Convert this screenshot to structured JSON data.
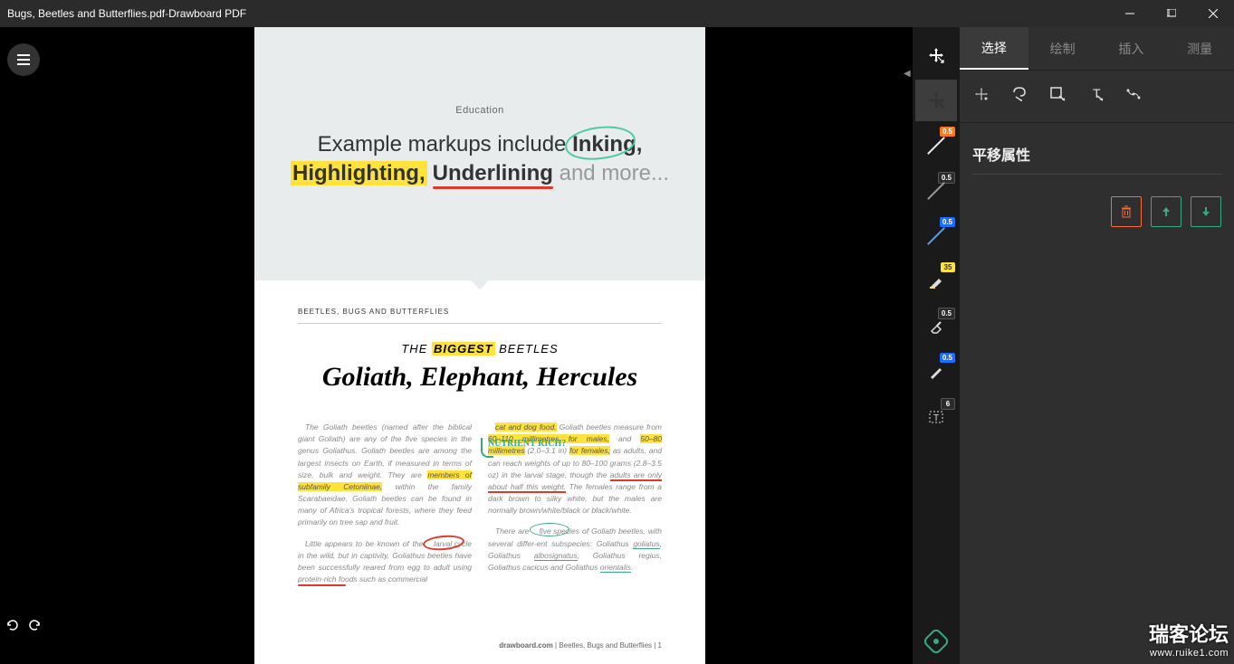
{
  "title": {
    "filename": "Bugs, Beetles and Butterflies.pdf",
    "sep": " - ",
    "app": "Drawboard PDF"
  },
  "header": {
    "category": "Education",
    "line1_a": "Example markups include ",
    "inking": "Inking,",
    "highlighting": "Highlighting,",
    "underlining": "Underlining",
    "andmore": " and more..."
  },
  "doc": {
    "smallcaps": "BEETLES, BUGS AND BUTTERFLIES",
    "the": "THE ",
    "biggest": "BIGGEST",
    "beetles": " BEETLES",
    "title2": "Goliath, Elephant, Hercules",
    "nutrient": "NUTRIENT RICH?",
    "col1p1a": "The Goliath beetles (named after the biblical giant Goliath) are any of the five species in the genus Goliathus. Goliath beetles are among the largest insects on Earth, if measured in terms of size, bulk and weight. They are ",
    "col1p1hl": "members of subfamily Cetoniinae,",
    "col1p1b": " within the family Scarabaeidae. Goliath beetles can be found in many of Africa's tropical forests, where they feed primarily on tree sap and fruit.",
    "col1p2a": "Little appears to be known of the ",
    "col1p2circle": "larval cycle",
    "col1p2b": " in the wild, but in captivity, Goliathus beetles have been successfully reared from egg to adult using ",
    "col1p2ul": "protein-rich",
    "col1p2c": " foods such as commercial",
    "col2p1a_hl": "cat and dog food.",
    "col2p1b": " Goliath beetles measure from ",
    "col2p1c_hl": "60–110 millimetres for males,",
    "col2p1d": " and ",
    "col2p1e_hl": "50–80 millimetres",
    "col2p1f": " (2.0–3.1 in) ",
    "col2p1g_hl": "for females,",
    "col2p1h": " as adults, and can reach weights of up to 80–100 grams (2.8–3.5 oz) in the larval stage, though the ",
    "col2p1i_ul": "adults are only about half this weight.",
    "col2p1j": " The females range from a dark brown to silky white, but the males are normally brown/white/black or black/white.",
    "col2p2a": "There are ",
    "col2p2circle": "five species",
    "col2p2b": " of Goliath beetles, with several differ-ent subspecies: Goliathus ",
    "col2p2ul1": "goliatus",
    "col2p2c": ", Goliathus ",
    "col2p2ul2": "albosignatus",
    "col2p2d": ", Goliathus regius, Goliathus cacicus and Goliathus ",
    "col2p2ul3": "orientalis",
    "col2p2e": ".",
    "footer_site": "drawboard.com",
    "footer_rest": "   |   Beetles, Bugs and Butterflies   |   1"
  },
  "mid_tools": [
    {
      "name": "pan-tool",
      "badge": null
    },
    {
      "name": "pen-orange",
      "badge": "0.5",
      "badgeColor": "orange"
    },
    {
      "name": "pen-gray",
      "badge": "0.5",
      "badgeColor": "dkgray"
    },
    {
      "name": "pen-blue",
      "badge": "0.5",
      "badgeColor": "blue"
    },
    {
      "name": "highlighter",
      "badge": "35",
      "badgeColor": "yellow"
    },
    {
      "name": "eraser",
      "badge": "0.5",
      "badgeColor": "dkgray"
    },
    {
      "name": "pen-blue2",
      "badge": "0.5",
      "badgeColor": "blue"
    },
    {
      "name": "text-tool",
      "badge": "6",
      "badgeColor": "dkgray"
    }
  ],
  "tabs": {
    "select": "选择",
    "draw": "绘制",
    "insert": "插入",
    "measure": "测量"
  },
  "panel": {
    "prop_title": "平移属性"
  },
  "watermark": {
    "l1": "瑞客论坛",
    "l2": "www.ruike1.com"
  }
}
